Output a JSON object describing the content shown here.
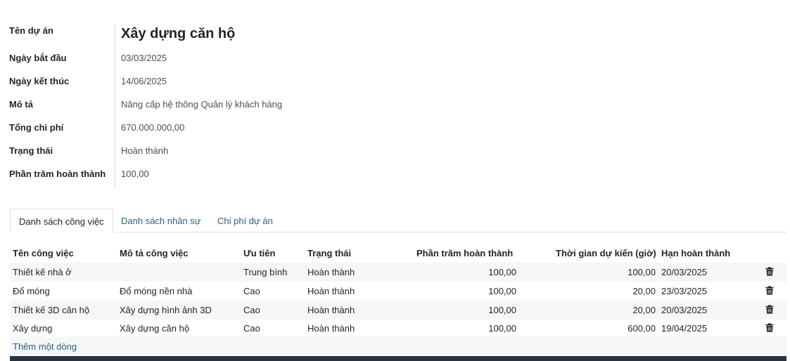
{
  "form": {
    "fields": [
      {
        "label": "Tên dự án",
        "value": "Xây dựng căn hộ"
      },
      {
        "label": "Ngày bắt đầu",
        "value": "03/03/2025"
      },
      {
        "label": "Ngày kết thúc",
        "value": "14/06/2025"
      },
      {
        "label": "Mô tả",
        "value": "Nâng cấp hệ thông Quản lý khách hàng"
      },
      {
        "label": "Tổng chi phí",
        "value": "670.000.000,00"
      },
      {
        "label": "Trạng thái",
        "value": "Hoàn thành"
      },
      {
        "label": "Phần trăm hoàn thành",
        "value": "100,00"
      }
    ]
  },
  "tabs": [
    {
      "label": "Danh sách công việc",
      "active": true
    },
    {
      "label": "Danh sách nhân sự",
      "active": false
    },
    {
      "label": "Chi phí dự án",
      "active": false
    }
  ],
  "table": {
    "headers": [
      "Tên công việc",
      "Mô tả công việc",
      "Ưu tiên",
      "Trạng thái",
      "Phần trăm hoàn thành",
      "Thời gian dự kiến (giờ)",
      "Hạn hoàn thành"
    ],
    "rows": [
      {
        "name": "Thiết kế nhà ở",
        "desc": "",
        "priority": "Trung bình",
        "status": "Hoàn thành",
        "percent": "100,00",
        "hours": "100,00",
        "deadline": "20/03/2025"
      },
      {
        "name": "Đổ móng",
        "desc": "Đổ móng nền nhà",
        "priority": "Cao",
        "status": "Hoàn thành",
        "percent": "100,00",
        "hours": "20,00",
        "deadline": "23/03/2025"
      },
      {
        "name": "Thiết kế 3D căn hộ",
        "desc": "Xây dựng hình ảnh 3D",
        "priority": "Cao",
        "status": "Hoàn thành",
        "percent": "100,00",
        "hours": "20,00",
        "deadline": "20/03/2025"
      },
      {
        "name": "Xây dựng",
        "desc": "Xây dựng căn hộ",
        "priority": "Cao",
        "status": "Hoàn thành",
        "percent": "100,00",
        "hours": "600,00",
        "deadline": "19/04/2025"
      }
    ],
    "add_line": "Thêm một dòng",
    "row_action_icon": "trash-icon"
  },
  "colors": {
    "link": "#2d5f83",
    "stripe": "#f5f6f7",
    "footer_bar": "#263340"
  }
}
